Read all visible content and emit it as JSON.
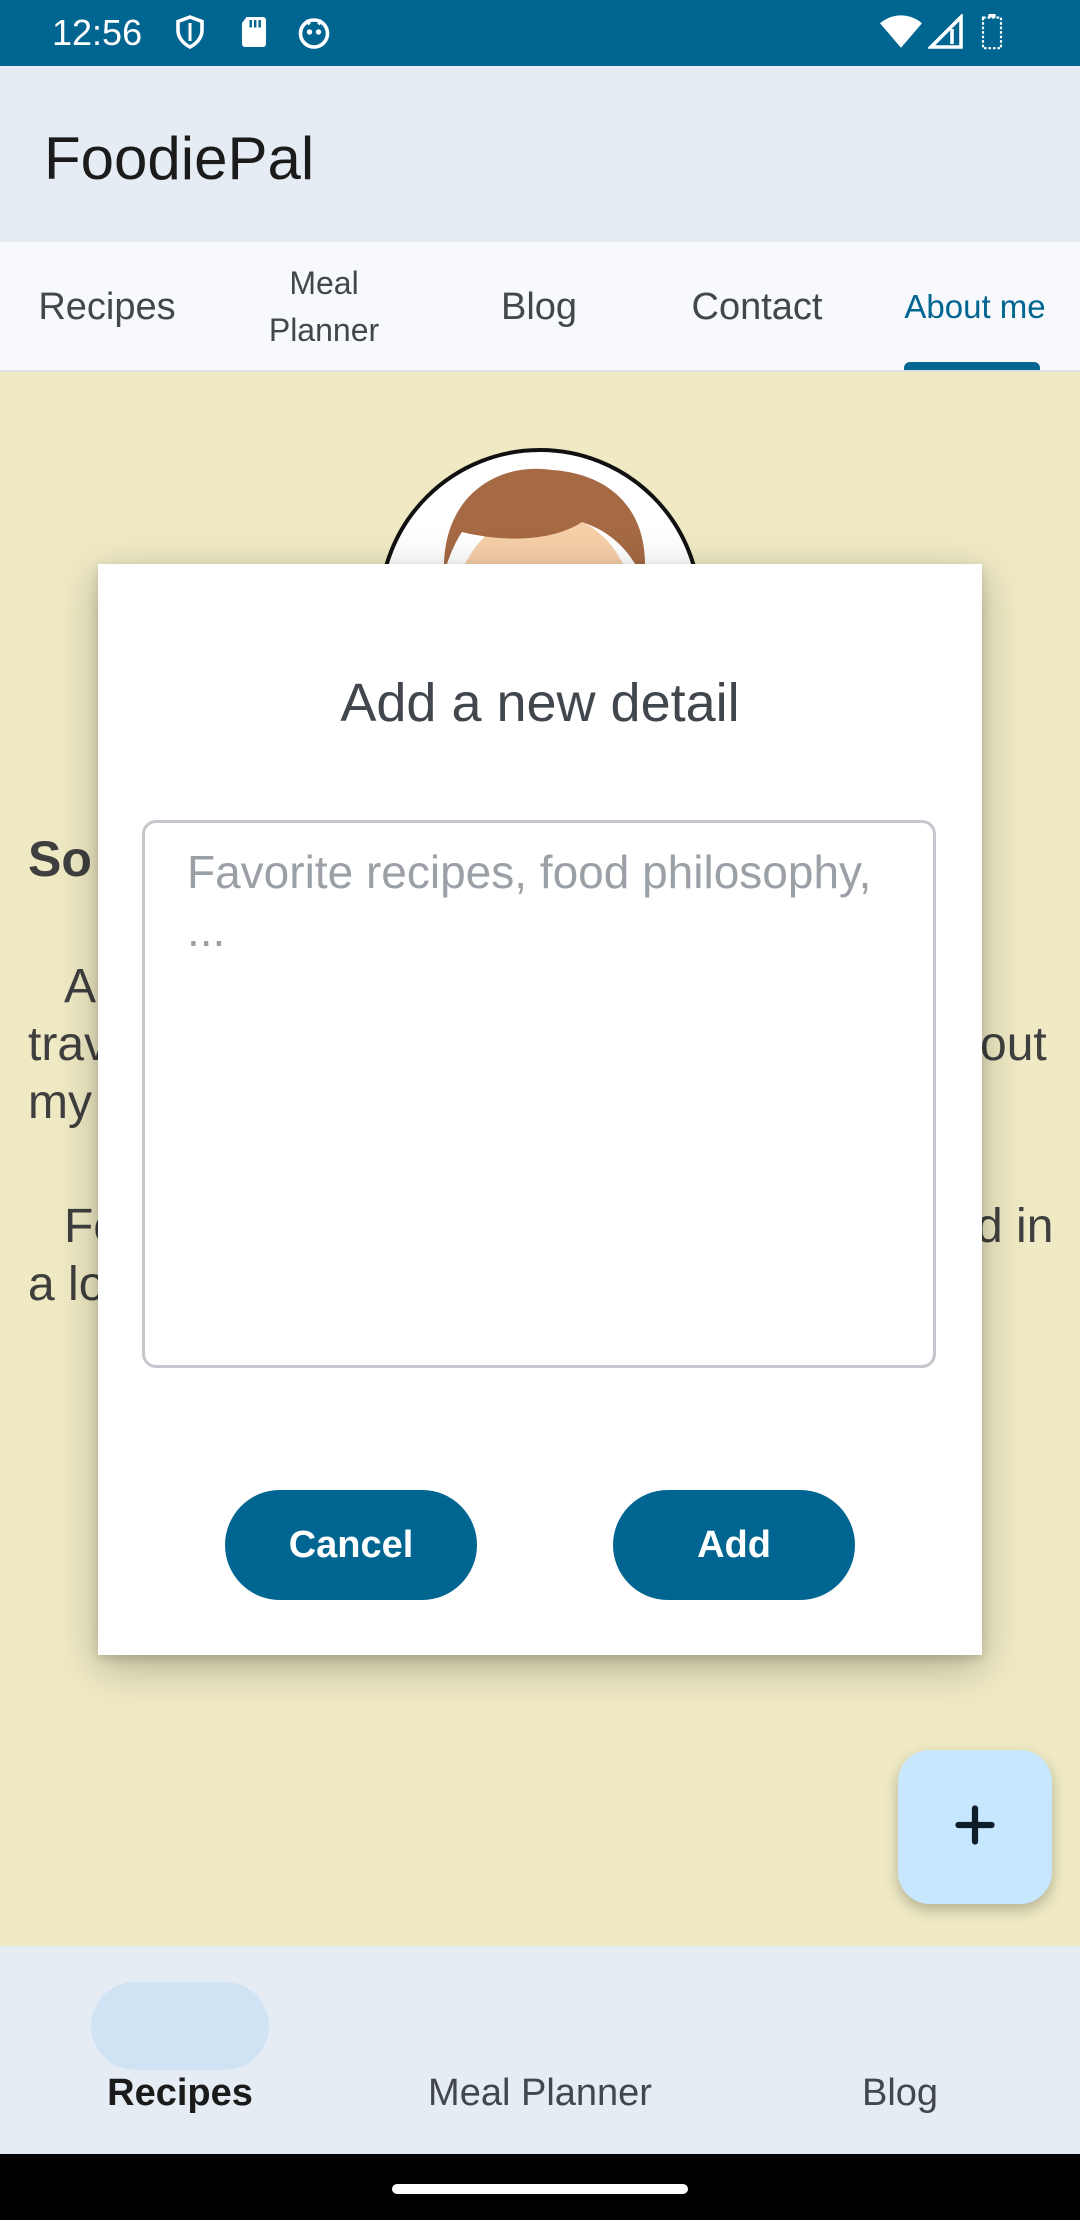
{
  "status_bar": {
    "time": "12:56",
    "icons_left": [
      "shield-icon",
      "sd-card-icon",
      "android-debug-icon"
    ],
    "icons_right": [
      "wifi-icon",
      "cell-signal-icon",
      "battery-icon"
    ],
    "color": "#006590"
  },
  "app": {
    "title": "FoodiePal"
  },
  "tabs": [
    {
      "label": "Recipes",
      "active": false
    },
    {
      "label": "Meal Planner",
      "active": false
    },
    {
      "label": "Blog",
      "active": false
    },
    {
      "label": "Contact",
      "active": false
    },
    {
      "label": "About me",
      "active": true
    }
  ],
  "background": {
    "heading_fragment": "So",
    "line1_left": "A",
    "line2_left": "trav",
    "line2_right": "out",
    "line3_left": "my",
    "line4_left": "Fo",
    "line4_right": "d in",
    "line5_left": "a lo"
  },
  "dialog": {
    "title": "Add a new detail",
    "input_placeholder": "Favorite recipes, food philosophy, ...",
    "input_value": "",
    "cancel_label": "Cancel",
    "add_label": "Add"
  },
  "fab": {
    "icon": "plus-icon"
  },
  "bottom_nav": [
    {
      "label": "Recipes",
      "active": true
    },
    {
      "label": "Meal Planner",
      "active": false
    },
    {
      "label": "Blog",
      "active": false
    }
  ],
  "colors": {
    "primary": "#006590",
    "background": "#efeac4",
    "fab": "#c7e7ff",
    "nav_pill": "#cfe3f5"
  }
}
